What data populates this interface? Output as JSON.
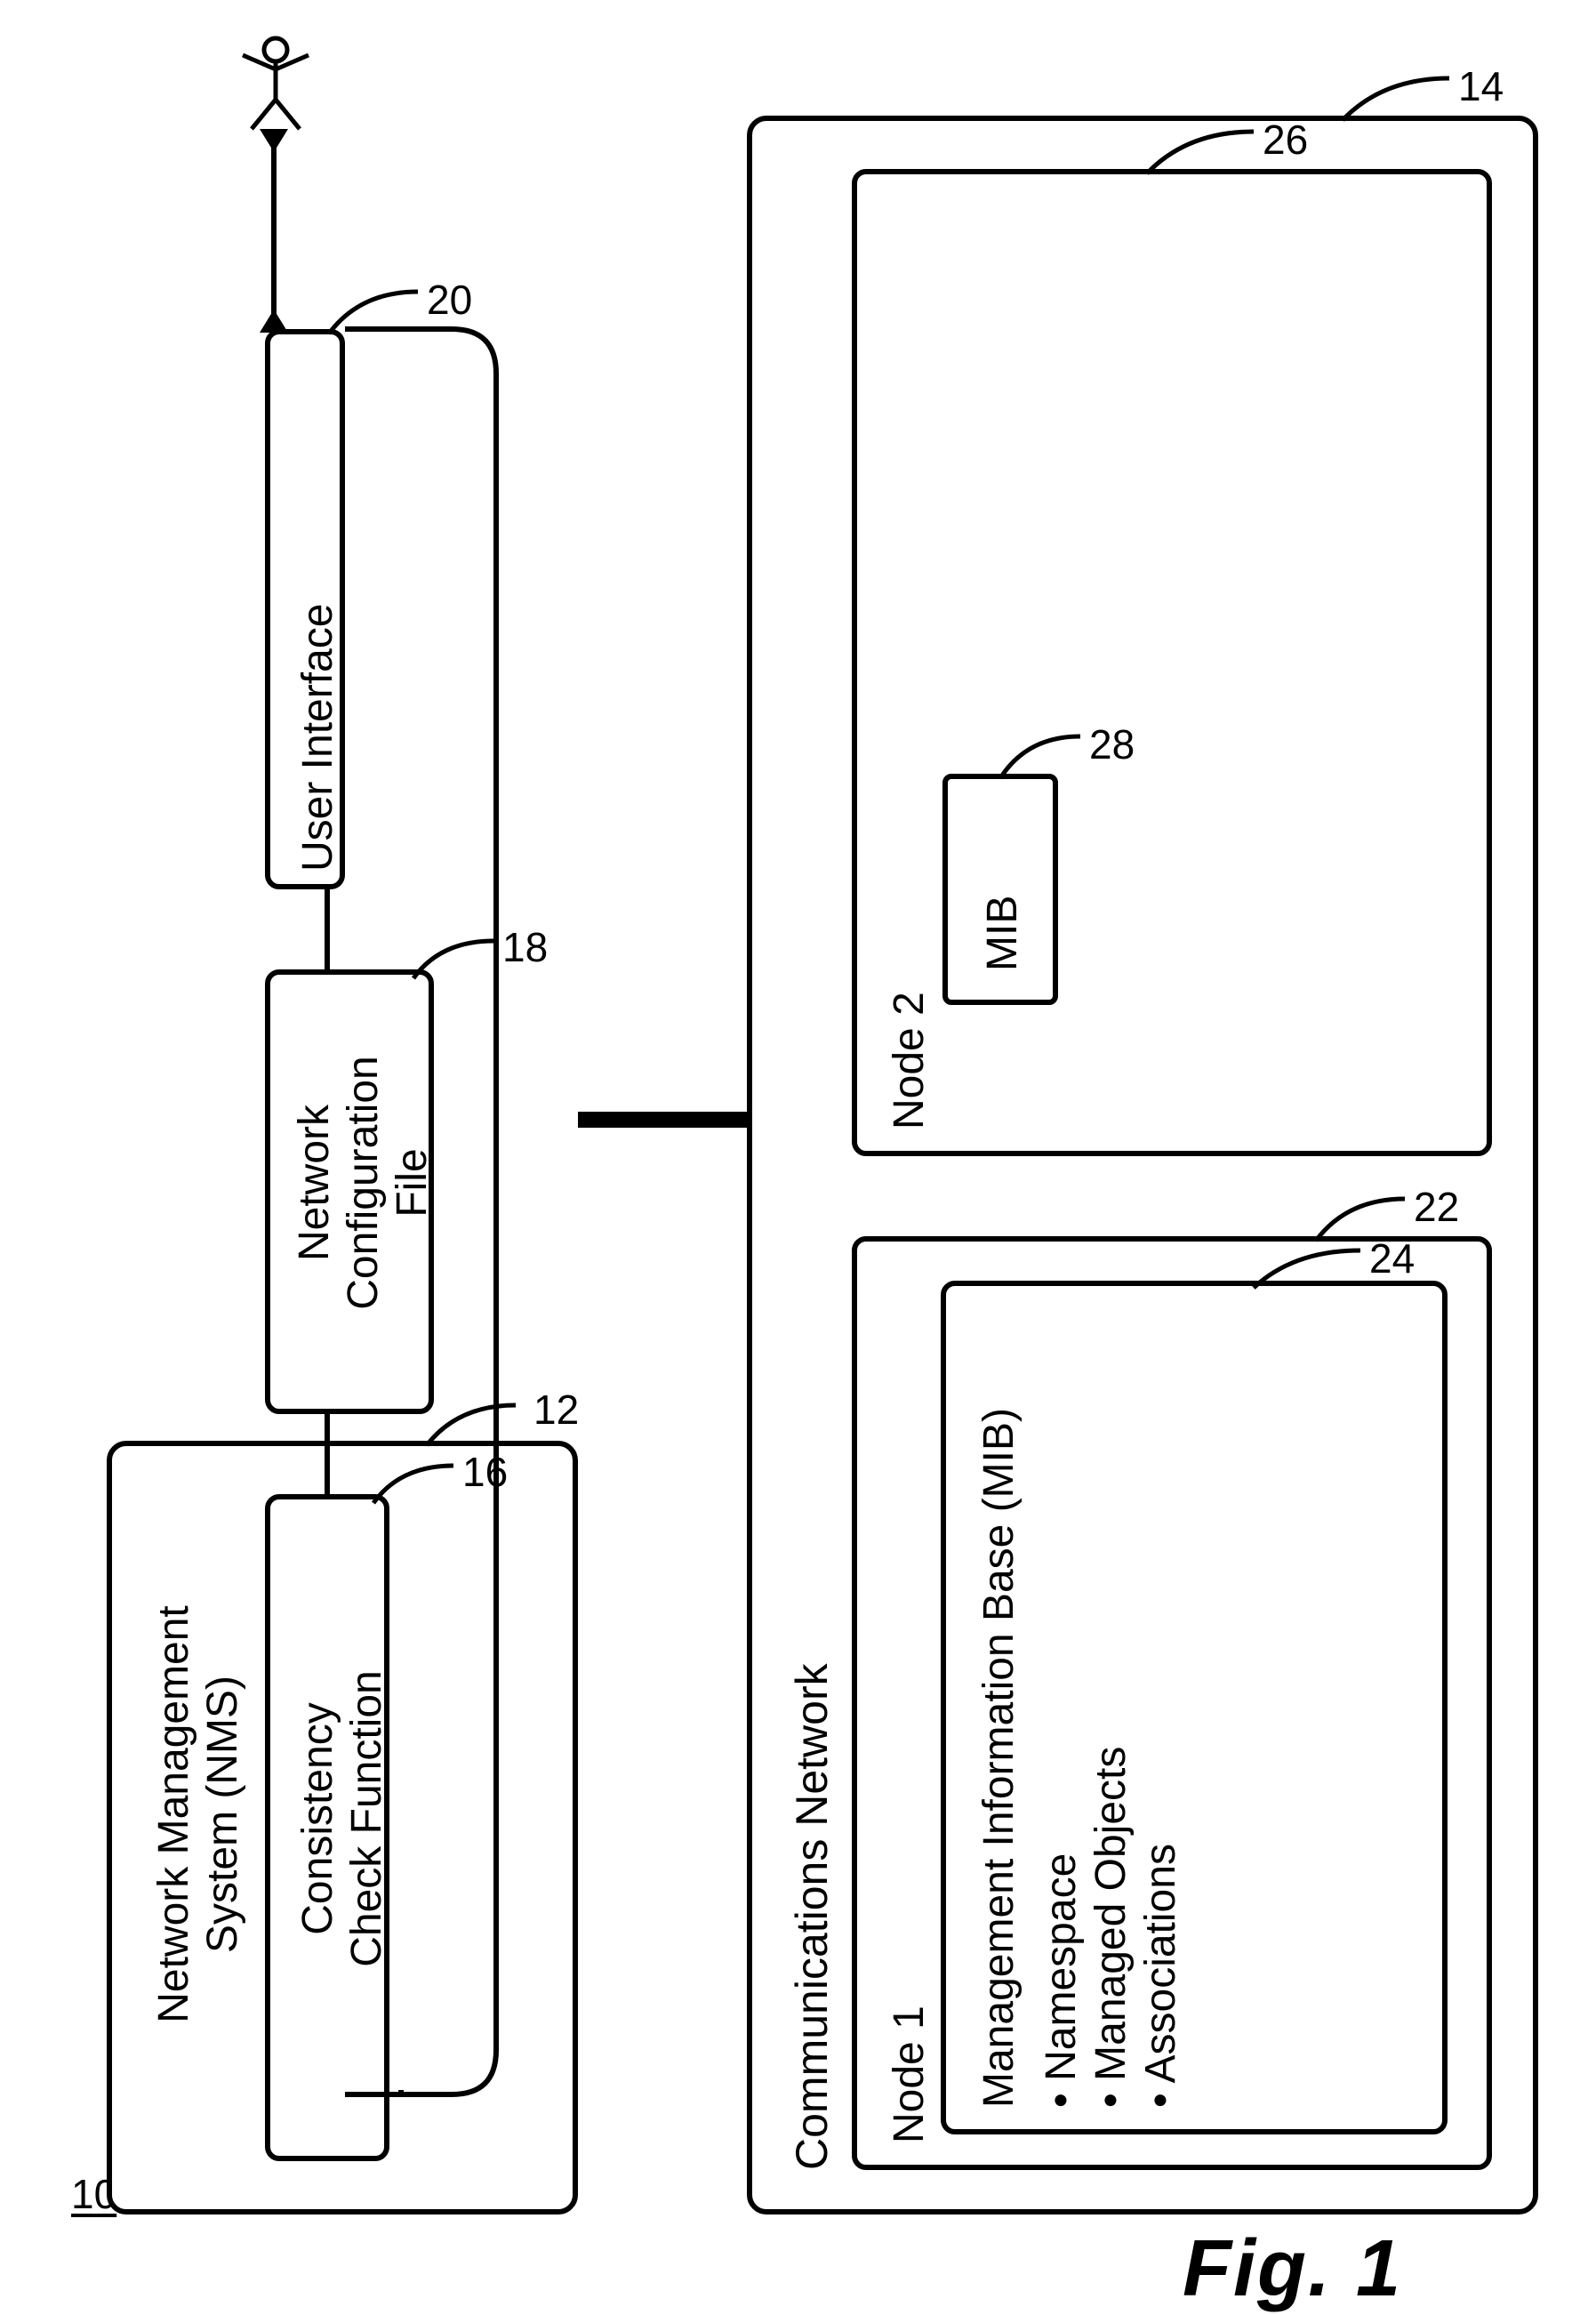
{
  "figure_label": "Fig. 1",
  "refs": {
    "r10": "10",
    "r12": "12",
    "r14": "14",
    "r16": "16",
    "r18": "18",
    "r20": "20",
    "r22": "22",
    "r24": "24",
    "r26": "26",
    "r28": "28"
  },
  "nms": {
    "title_l1": "Network Management",
    "title_l2": "System (NMS)",
    "consistency_l1": "Consistency",
    "consistency_l2": "Check Function",
    "config_l1": "Network",
    "config_l2": "Configuration",
    "config_l3": "File",
    "ui": "User Interface"
  },
  "network": {
    "title": "Communications Network",
    "node1": "Node 1",
    "node2": "Node 2",
    "mib_title": "Management Information Base (MIB)",
    "mib_b1": "• Namespace",
    "mib_b2": "• Managed Objects",
    "mib_b3": "• Associations",
    "mib_small": "MIB"
  }
}
